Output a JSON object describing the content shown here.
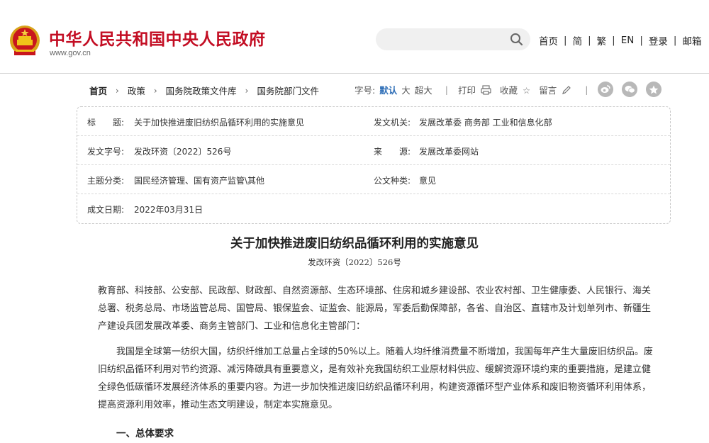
{
  "header": {
    "site_title": "中华人民共和国中央人民政府",
    "site_url": "www.gov.cn",
    "search": {
      "value": "",
      "placeholder": ""
    },
    "nav": [
      "首页",
      "简",
      "繁",
      "EN",
      "登录",
      "邮箱"
    ]
  },
  "breadcrumb": [
    "首页",
    "政策",
    "国务院政策文件库",
    "国务院部门文件"
  ],
  "tools": {
    "font_size_label": "字号:",
    "sizes": [
      "默认",
      "大",
      "超大"
    ],
    "active_size": "默认",
    "print": "打印",
    "favorite": "收藏",
    "comment": "留言"
  },
  "share_icons": [
    "weibo-icon",
    "wechat-icon",
    "qzone-icon"
  ],
  "info": {
    "title_key": "标　　题:",
    "title_value": "关于加快推进废旧纺织品循环利用的实施意见",
    "issuer_key": "发文机关:",
    "issuer_value": "发展改革委 商务部 工业和信息化部",
    "docno_key": "发文字号:",
    "docno_value": "发改环资〔2022〕526号",
    "source_key": "来　　源:",
    "source_value": "发展改革委网站",
    "topic_key": "主题分类:",
    "topic_value": "国民经济管理、国有资产监管\\其他",
    "type_key": "公文种类:",
    "type_value": "意见",
    "date_key": "成文日期:",
    "date_value": "2022年03月31日"
  },
  "article": {
    "title": "关于加快推进废旧纺织品循环利用的实施意见",
    "doc_no": "发改环资〔2022〕526号",
    "recipients": "教育部、科技部、公安部、民政部、财政部、自然资源部、生态环境部、住房和城乡建设部、农业农村部、卫生健康委、人民银行、海关总署、税务总局、市场监管总局、国管局、银保监会、证监会、能源局，军委后勤保障部，各省、自治区、直辖市及计划单列市、新疆生产建设兵团发展改革委、商务主管部门、工业和信息化主管部门：",
    "intro": "我国是全球第一纺织大国，纺织纤维加工总量占全球的50%以上。随着人均纤维消费量不断增加，我国每年产生大量废旧纺织品。废旧纺织品循环利用对节约资源、减污降碳具有重要意义，是有效补充我国纺织工业原材料供应、缓解资源环境约束的重要措施，是建立健全绿色低碳循环发展经济体系的重要内容。为进一步加快推进废旧纺织品循环利用，构建资源循环型产业体系和废旧物资循环利用体系，提高资源利用效率，推动生态文明建设，制定本实施意见。",
    "section1": "一、总体要求"
  },
  "colors": {
    "brand_red": "#c30d23",
    "active_blue": "#2f6fb7"
  }
}
